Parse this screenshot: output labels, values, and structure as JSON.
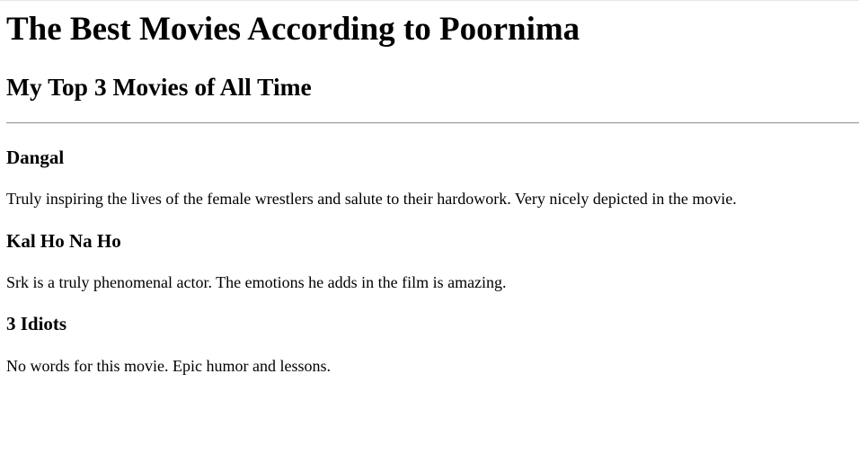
{
  "page": {
    "title": "The Best Movies According to Poornima",
    "subtitle": "My Top 3 Movies of All Time"
  },
  "movies": [
    {
      "title": "Dangal",
      "description": "Truly inspiring the lives of the female wrestlers and salute to their hardowork. Very nicely depicted in the movie."
    },
    {
      "title": "Kal Ho Na Ho",
      "description": "Srk is a truly phenomenal actor. The emotions he adds in the film is amazing."
    },
    {
      "title": "3 Idiots",
      "description": "No words for this movie. Epic humor and lessons."
    }
  ]
}
